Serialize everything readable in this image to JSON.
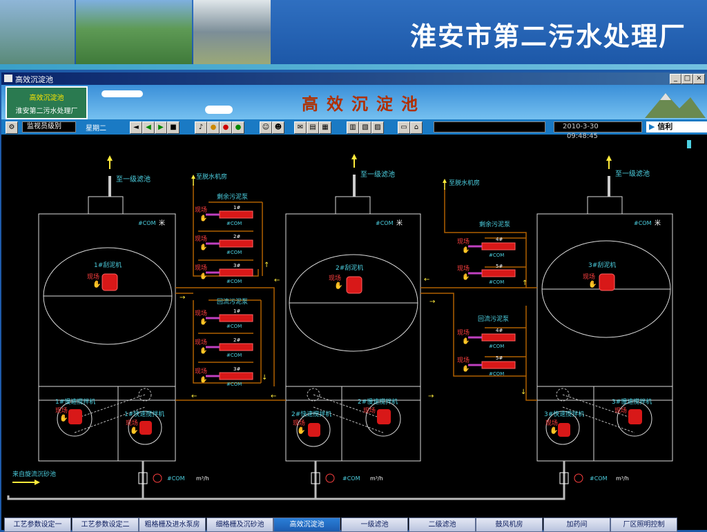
{
  "banner": {
    "title": "淮安市第二污水处理厂"
  },
  "window": {
    "title": "高效沉淀池"
  },
  "header": {
    "title": "高效沉淀池",
    "logo_text": "高效沉淀池",
    "logo_text2": "淮安第二污水处理厂"
  },
  "toolbar": {
    "role": "监视员级别",
    "weekday": "星期二",
    "date": "2010-3-30",
    "time": "09:48:45",
    "brand": "信利"
  },
  "diagram": {
    "to_primary_filter": "至一级滤池",
    "to_dewater": "至脱水机房",
    "excess_pump": "剩余污泥泵",
    "return_pump": "回流污泥泵",
    "local": "现场",
    "com": "#COM",
    "unit_m": "米",
    "scraper1": "1#刮泥机",
    "scraper2": "2#刮泥机",
    "scraper3": "3#刮泥机",
    "slow_mixer1": "1#慢速搅拌机",
    "fast_mixer1": "1#快速搅拌机",
    "slow_mixer2": "2#慢速搅拌机",
    "fast_mixer2": "2#快速搅拌机",
    "slow_mixer3": "3#慢速搅拌机",
    "fast_mixer3": "3#快速搅拌机",
    "inflow": "来自旋流沉砂池",
    "flow_unit": "m³/h",
    "pumps": [
      "1#",
      "2#",
      "3#",
      "4#",
      "5#"
    ]
  },
  "nav": {
    "items": [
      "工艺参数设定一",
      "工艺参数设定二",
      "粗格栅及进水泵房",
      "细格栅及沉砂池",
      "高效沉淀池",
      "一级滤池",
      "二级滤池",
      "鼓风机房",
      "加药间",
      "厂区照明控制"
    ],
    "active": 4
  }
}
